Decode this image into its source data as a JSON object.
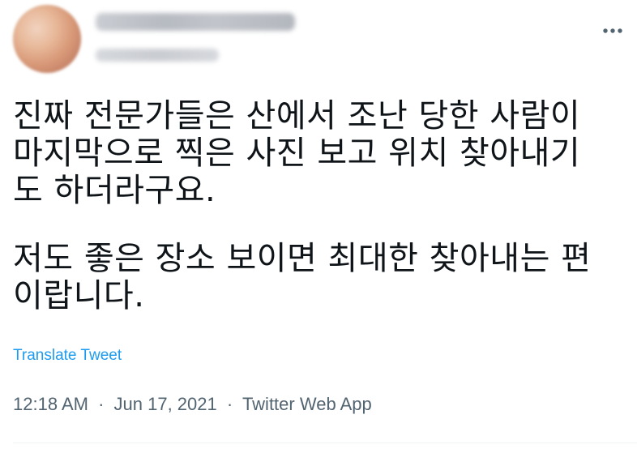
{
  "tweet": {
    "text_lines_p1": [
      "진짜 전문가들은 산에서 조난 당한 사람이",
      "마지막으로 찍은 사진 보고 위치 찾아내기",
      "도 하더라구요."
    ],
    "text_lines_p2": [
      "저도 좋은 장소 보이면 최대한 찾아내는 편",
      "이랍니다."
    ],
    "translate_label": "Translate Tweet",
    "time": "12:18 AM",
    "date": "Jun 17, 2021",
    "source": "Twitter Web App",
    "separator": "·"
  },
  "icons": {
    "more": "more-horizontal-icon"
  },
  "colors": {
    "text": "#0f1419",
    "link": "#1d9bf0",
    "meta": "#536471"
  }
}
